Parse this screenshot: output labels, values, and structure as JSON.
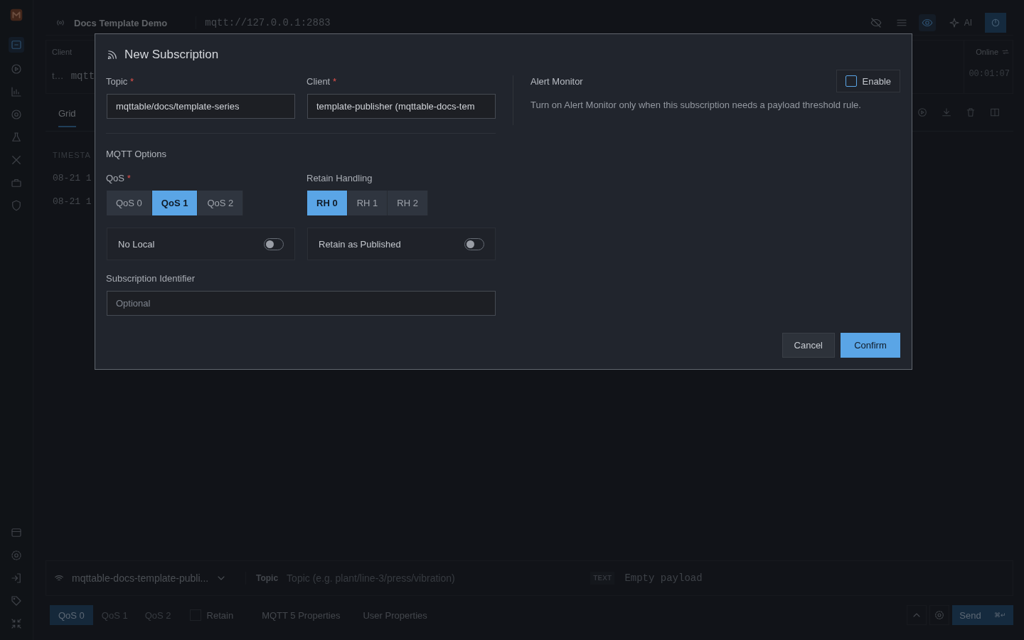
{
  "sidebar": {
    "top_items": [
      {
        "selected": true
      },
      {
        "selected": false
      },
      {
        "selected": false
      },
      {
        "selected": false
      },
      {
        "selected": false
      },
      {
        "selected": false
      },
      {
        "selected": false
      },
      {
        "selected": false
      }
    ],
    "bottom_items": [
      {
        "selected": false
      },
      {
        "selected": false
      },
      {
        "selected": false
      },
      {
        "selected": false
      },
      {
        "selected": false
      }
    ]
  },
  "header": {
    "title": "Docs Template Demo",
    "url": "mqtt://127.0.0.1:2883",
    "ai_label": "AI"
  },
  "client_panel": {
    "label": "Client",
    "client": "t…",
    "name": "mqtt",
    "status": "Online",
    "uptime": "00:01:07"
  },
  "view_tabs": [
    {
      "label": "Grid",
      "selected": true
    }
  ],
  "table": {
    "columns": [
      "TIMESTA"
    ],
    "rows": [
      [
        "08-21 1"
      ],
      [
        "08-21 1"
      ]
    ]
  },
  "composer": {
    "connection": "mqttable-docs-template-publi...",
    "topic_label": "Topic",
    "topic_placeholder": "Topic (e.g. plant/line-3/press/vibration)",
    "format": "TEXT",
    "payload_placeholder": "Empty payload",
    "qos": [
      {
        "label": "QoS 0",
        "selected": true
      },
      {
        "label": "QoS 1",
        "selected": false
      },
      {
        "label": "QoS 2",
        "selected": false
      }
    ],
    "retain": {
      "label": "Retain",
      "checked": false
    },
    "menus": [
      "MQTT 5 Properties",
      "User Properties"
    ],
    "send": {
      "label": "Send",
      "shortcut": "⌘↵"
    }
  },
  "dialog": {
    "title": "New Subscription",
    "topic": {
      "label": "Topic",
      "required_mark": "*",
      "value": "mqttable/docs/template-series"
    },
    "client": {
      "label": "Client",
      "required_mark": "*",
      "value": "template-publisher (mqttable-docs-tem"
    },
    "mqtt_options": {
      "heading": "MQTT Options",
      "qos": {
        "label": "QoS",
        "required_mark": "*",
        "options": [
          {
            "label": "QoS 0",
            "selected": false
          },
          {
            "label": "QoS 1",
            "selected": true
          },
          {
            "label": "QoS 2",
            "selected": false
          }
        ]
      },
      "retain_handling": {
        "label": "Retain Handling",
        "options": [
          {
            "label": "RH 0",
            "selected": true
          },
          {
            "label": "RH 1",
            "selected": false
          },
          {
            "label": "RH 2",
            "selected": false
          }
        ]
      },
      "toggles": [
        {
          "label": "No Local",
          "on": false
        },
        {
          "label": "Retain as Published",
          "on": false
        }
      ],
      "subscription_identifier": {
        "label": "Subscription Identifier",
        "placeholder": "Optional"
      }
    },
    "alert_monitor": {
      "title": "Alert Monitor",
      "enable": {
        "label": "Enable",
        "checked": false
      },
      "description": "Turn on Alert Monitor only when this subscription needs a payload threshold rule."
    },
    "buttons": [
      {
        "label": "Cancel",
        "kind": "secondary"
      },
      {
        "label": "Confirm",
        "kind": "primary"
      }
    ]
  }
}
